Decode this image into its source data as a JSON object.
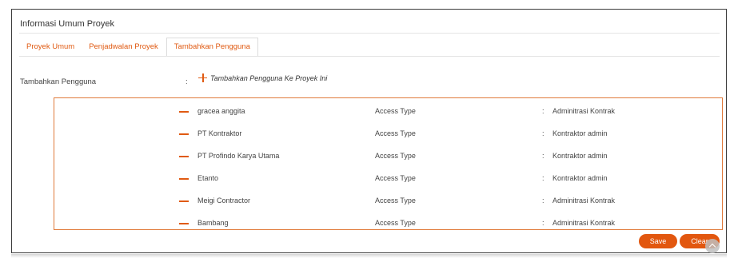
{
  "page": {
    "title": "Informasi Umum Proyek"
  },
  "tabs": [
    {
      "label": "Proyek Umum",
      "active": false
    },
    {
      "label": "Penjadwalan Proyek",
      "active": false
    },
    {
      "label": "Tambahkan Pengguna",
      "active": true
    }
  ],
  "add_user": {
    "label": "Tambahkan Pengguna",
    "colon": ":",
    "link_text": "Tambahkan Pengguna Ke Proyek Ini",
    "icon": "plus-icon"
  },
  "users": [
    {
      "name": "gracea anggita",
      "access_label": "Access Type",
      "access_colon": ":",
      "access_value": "Adminitrasi Kontrak"
    },
    {
      "name": "PT Kontraktor",
      "access_label": "Access Type",
      "access_colon": ":",
      "access_value": "Kontraktor admin"
    },
    {
      "name": "PT Profindo Karya Utama",
      "access_label": "Access Type",
      "access_colon": ":",
      "access_value": "Kontraktor admin"
    },
    {
      "name": "Etanto",
      "access_label": "Access Type",
      "access_colon": ":",
      "access_value": "Kontraktor admin"
    },
    {
      "name": "Meigi Contractor",
      "access_label": "Access Type",
      "access_colon": ":",
      "access_value": "Adminitrasi Kontrak"
    },
    {
      "name": "Bambang",
      "access_label": "Access Type",
      "access_colon": ":",
      "access_value": "Adminitrasi Kontrak"
    }
  ],
  "buttons": {
    "save_label": "Save",
    "clear_label": "Clear"
  },
  "colors": {
    "accent": "#e2570f",
    "box_border": "#e07a3a",
    "frame_border": "#3c3c3c"
  }
}
